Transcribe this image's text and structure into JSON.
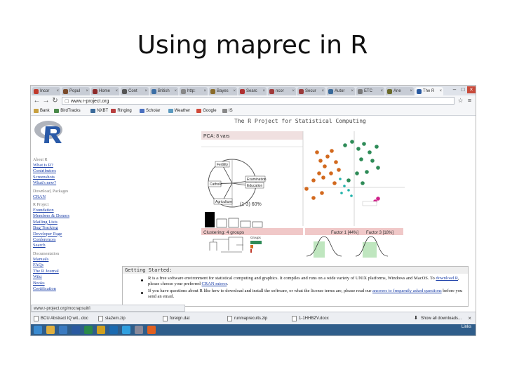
{
  "slide": {
    "title": "Using maprec in R"
  },
  "browser": {
    "tabs": [
      {
        "label": "Incor",
        "color": "#c0392b"
      },
      {
        "label": "Popul",
        "color": "#7a4a2a"
      },
      {
        "label": "Home",
        "color": "#8d2a2a"
      },
      {
        "label": "Cont",
        "color": "#555555"
      },
      {
        "label": "British",
        "color": "#3b6ea5"
      },
      {
        "label": "http:",
        "color": "#888888"
      },
      {
        "label": "Bayes",
        "color": "#8a6b2a"
      },
      {
        "label": "Searc",
        "color": "#b03030"
      },
      {
        "label": "ncor",
        "color": "#a03a3a"
      },
      {
        "label": "Secur",
        "color": "#9a3a3a"
      },
      {
        "label": "Autor",
        "color": "#3a6a9a"
      },
      {
        "label": "ETC",
        "color": "#7a7a7a"
      },
      {
        "label": "Ane",
        "color": "#6a6a2a"
      },
      {
        "label": "The R",
        "color": "#2a5aa0"
      }
    ],
    "url": "www.r-project.org",
    "bookmarks": [
      {
        "label": "Bank",
        "color": "#c8a040"
      },
      {
        "label": "BirdTracks",
        "color": "#4a8a4a"
      },
      {
        "label": "NXBT",
        "color": "#3a6a9a"
      },
      {
        "label": "Ringing",
        "color": "#b84040"
      },
      {
        "label": "Scholar",
        "color": "#4a70c0"
      },
      {
        "label": "Weather",
        "color": "#5a9ac0"
      },
      {
        "label": "Google",
        "color": "#d04a3a"
      },
      {
        "label": "IS",
        "color": "#888888"
      }
    ]
  },
  "site": {
    "title": "The R Project for Statistical Computing",
    "sidebar": [
      {
        "heading": "About R",
        "links": [
          "What is R?",
          "Contributors",
          "Screenshots",
          "What's new?"
        ]
      },
      {
        "heading": "Download, Packages",
        "links": [
          "CRAN"
        ]
      },
      {
        "heading": "R Project",
        "links": [
          "Foundation",
          "Members & Donors",
          "Mailing Lists",
          "Bug Tracking",
          "Developer Page",
          "Conferences",
          "Search"
        ]
      },
      {
        "heading": "Documentation",
        "links": [
          "Manuals",
          "FAQs",
          "The R Journal",
          "Wiki",
          "Books",
          "Certification"
        ]
      }
    ],
    "figure": {
      "pca_title": "PCA: 8 vars",
      "pca_labels": [
        "Fertility",
        "Catholic",
        "Examination",
        "Education",
        "Agriculture"
      ],
      "pca_footer": "(1-3) 60%",
      "cluster_label": "Clustering: 4 groups",
      "factor1": "Factor 1 [44%]",
      "factor3": "Factor 3 [18%]",
      "legend_label": "Groups",
      "legend_vals": [
        "a",
        "b",
        "c",
        "d"
      ],
      "colors": [
        "#d2691e",
        "#2e8b57",
        "#20b2aa",
        "#d0218a"
      ]
    },
    "getting_started": {
      "heading": "Getting Started:",
      "b1_pre": "R is a free software environment for statistical computing and graphics. It compiles and runs on a wide variety of UNIX platforms, Windows and MacOS. To",
      "b1_link": "download R",
      "b1_mid": ", please choose your preferred",
      "b1_link2": "CRAN mirror",
      "b1_end": ".",
      "b2_pre": "If you have questions about R like how to download and install the software, or what the license terms are, please read our",
      "b2_link": "answers to frequently asked questions",
      "b2_end": "before you send an email."
    }
  },
  "status_url": "www.r-project.org/mocrapsuit/i",
  "downloads": [
    "BCU Abstract IQ wit...doc",
    "sla2em.zip",
    "foreign.dat",
    "runmaprecults.zip",
    "1-1HHBZV.docx"
  ],
  "show_all": "Show all downloads...",
  "taskbar": {
    "icons": [
      {
        "name": "start-icon",
        "color": "#3a8ad0"
      },
      {
        "name": "explorer-icon",
        "color": "#e0b040"
      },
      {
        "name": "ie-icon",
        "color": "#3a7ac0"
      },
      {
        "name": "word-icon",
        "color": "#2a5aa0"
      },
      {
        "name": "excel-icon",
        "color": "#2a8a4a"
      },
      {
        "name": "chrome-icon",
        "color": "#d0a020"
      },
      {
        "name": "outlook-icon",
        "color": "#1a6ab0"
      },
      {
        "name": "skype-icon",
        "color": "#30a0e0"
      },
      {
        "name": "r-icon",
        "color": "#8a8a9a"
      },
      {
        "name": "firefox-icon",
        "color": "#e06020"
      }
    ],
    "time": "Links",
    "date": ""
  }
}
